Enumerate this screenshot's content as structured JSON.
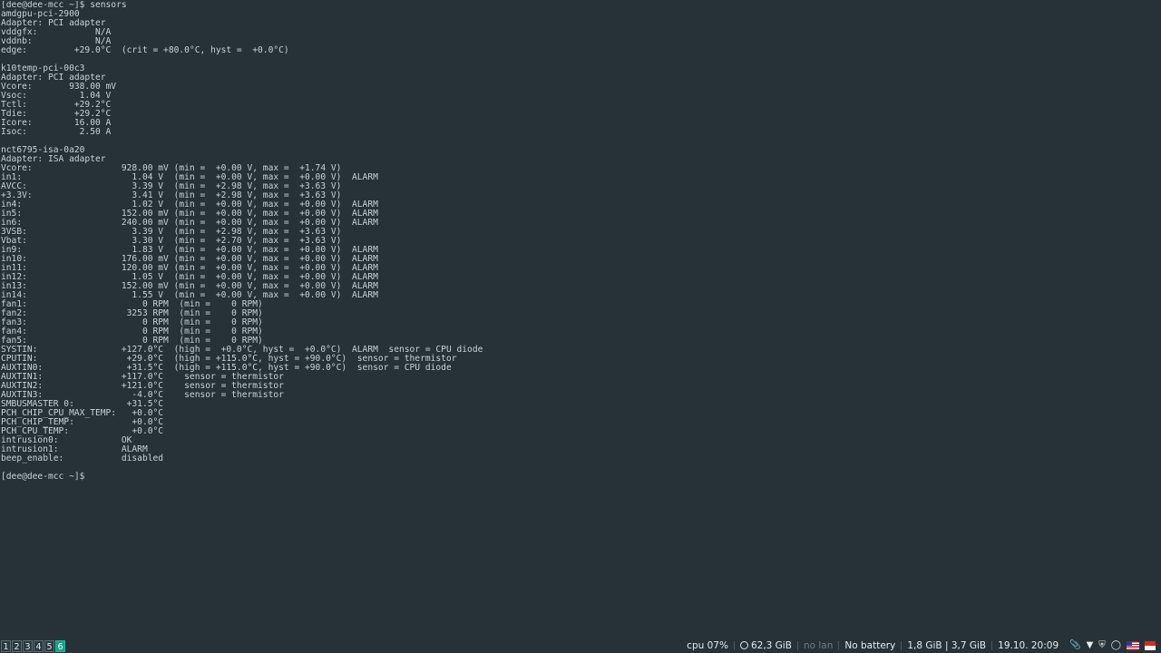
{
  "terminal": {
    "lines": [
      "[dee@dee-mcc ~]$ sensors",
      "amdgpu-pci-2900",
      "Adapter: PCI adapter",
      "vddgfx:           N/A",
      "vddnb:            N/A",
      "edge:         +29.0°C  (crit = +80.0°C, hyst =  +0.0°C)",
      "",
      "k10temp-pci-00c3",
      "Adapter: PCI adapter",
      "Vcore:       938.00 mV",
      "Vsoc:          1.04 V",
      "Tctl:         +29.2°C",
      "Tdie:         +29.2°C",
      "Icore:        16.00 A",
      "Isoc:          2.50 A",
      "",
      "nct6795-isa-0a20",
      "Adapter: ISA adapter",
      "Vcore:                 928.00 mV (min =  +0.00 V, max =  +1.74 V)",
      "in1:                     1.04 V  (min =  +0.00 V, max =  +0.00 V)  ALARM",
      "AVCC:                    3.39 V  (min =  +2.98 V, max =  +3.63 V)",
      "+3.3V:                   3.41 V  (min =  +2.98 V, max =  +3.63 V)",
      "in4:                     1.02 V  (min =  +0.00 V, max =  +0.00 V)  ALARM",
      "in5:                   152.00 mV (min =  +0.00 V, max =  +0.00 V)  ALARM",
      "in6:                   240.00 mV (min =  +0.00 V, max =  +0.00 V)  ALARM",
      "3VSB:                    3.39 V  (min =  +2.98 V, max =  +3.63 V)",
      "Vbat:                    3.30 V  (min =  +2.70 V, max =  +3.63 V)",
      "in9:                     1.83 V  (min =  +0.00 V, max =  +0.00 V)  ALARM",
      "in10:                  176.00 mV (min =  +0.00 V, max =  +0.00 V)  ALARM",
      "in11:                  120.00 mV (min =  +0.00 V, max =  +0.00 V)  ALARM",
      "in12:                    1.05 V  (min =  +0.00 V, max =  +0.00 V)  ALARM",
      "in13:                  152.00 mV (min =  +0.00 V, max =  +0.00 V)  ALARM",
      "in14:                    1.55 V  (min =  +0.00 V, max =  +0.00 V)  ALARM",
      "fan1:                      0 RPM  (min =    0 RPM)",
      "fan2:                   3253 RPM  (min =    0 RPM)",
      "fan3:                      0 RPM  (min =    0 RPM)",
      "fan4:                      0 RPM  (min =    0 RPM)",
      "fan5:                      0 RPM  (min =    0 RPM)",
      "SYSTIN:                +127.0°C  (high =  +0.0°C, hyst =  +0.0°C)  ALARM  sensor = CPU diode",
      "CPUTIN:                 +29.0°C  (high = +115.0°C, hyst = +90.0°C)  sensor = thermistor",
      "AUXTIN0:                +31.5°C  (high = +115.0°C, hyst = +90.0°C)  sensor = CPU diode",
      "AUXTIN1:               +117.0°C    sensor = thermistor",
      "AUXTIN2:               +121.0°C    sensor = thermistor",
      "AUXTIN3:                 -4.0°C    sensor = thermistor",
      "SMBUSMASTER 0:          +31.5°C",
      "PCH_CHIP_CPU_MAX_TEMP:   +0.0°C",
      "PCH_CHIP_TEMP:           +0.0°C",
      "PCH_CPU_TEMP:            +0.0°C",
      "intrusion0:            OK",
      "intrusion1:            ALARM",
      "beep_enable:           disabled",
      "",
      "[dee@dee-mcc ~]$"
    ]
  },
  "statusbar": {
    "workspaces": [
      {
        "label": "1",
        "active": false
      },
      {
        "label": "2",
        "active": false
      },
      {
        "label": "3",
        "active": false
      },
      {
        "label": "4",
        "active": false
      },
      {
        "label": "5",
        "active": false
      },
      {
        "label": "6",
        "active": true
      }
    ],
    "cpu": "cpu  07%",
    "disk": "62,3 GiB",
    "lan": "no lan",
    "battery": "No battery",
    "memory": "1,8 GiB | 3,7 GiB",
    "datetime": "19.10. 20:09"
  },
  "icons": {
    "tray": [
      "paperclip-icon",
      "wifi-icon",
      "shield-icon",
      "bell-icon",
      "us-flag-icon",
      "keyboard-layout-flag-icon"
    ],
    "accent_color": "#16a085",
    "background_color": "#263238",
    "text_color": "#c9d1d6"
  }
}
